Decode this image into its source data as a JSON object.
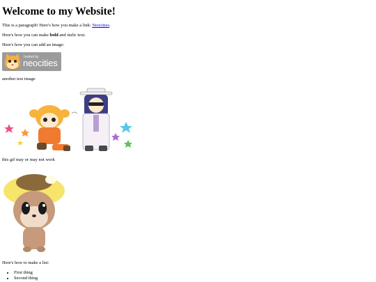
{
  "page": {
    "heading": "Welcome to my Website!",
    "paragraph_text": "This is a paragraph! Here's how you make a link: ",
    "link_text": "Neocities",
    "paragraph_end": ".",
    "bold_prefix": "Here's how you can make ",
    "bold_word": "bold",
    "bold_middle": " and ",
    "italic_word": "italic",
    "bold_suffix": " text.",
    "image_intro": "Here's how you can add an image:",
    "badge_hosted": "hosted by",
    "badge_brand": "neocities",
    "test_image_caption": "another test image",
    "gif_caption": "this gif may or may not work",
    "list_intro": "Here's how to make a list:",
    "list_items": [
      "First thing",
      "Second thing"
    ]
  },
  "icons": {
    "badge_cat": "neocities-cat-icon",
    "anime_pair": "anime-duo-image",
    "otter": "otter-gif-image"
  },
  "colors": {
    "link": "#0000ee",
    "badge_bg": "#9b9b9b",
    "text": "#000000"
  }
}
